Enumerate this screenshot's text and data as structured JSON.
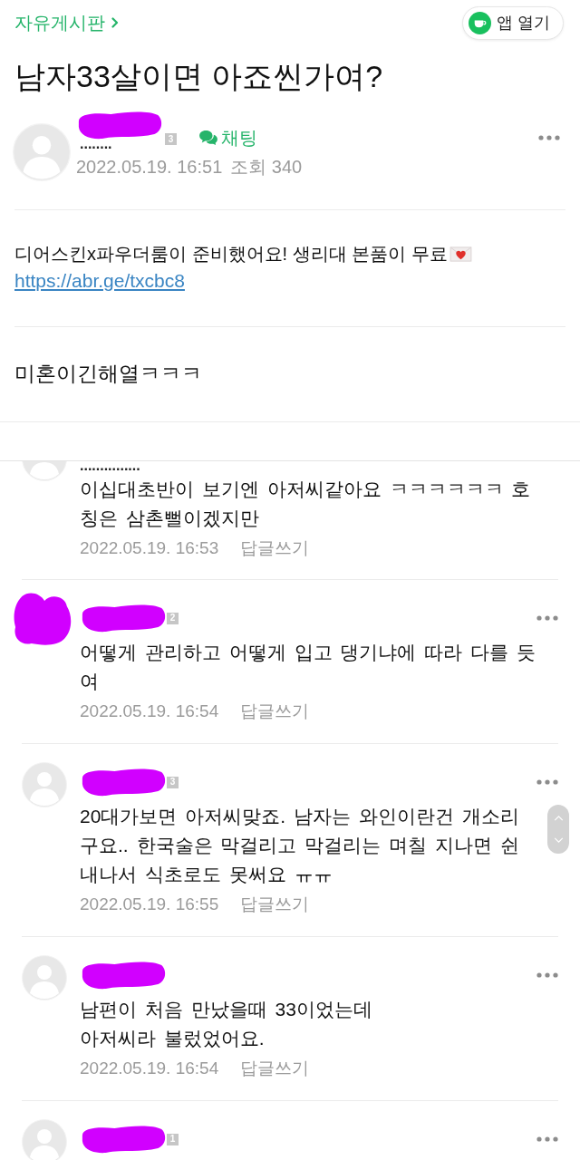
{
  "header": {
    "board_link": "자유게시판",
    "app_button": "앱 열기"
  },
  "post": {
    "title": "남자33살이면 아죠씬가여?",
    "author": {
      "name": "........",
      "redacted": true,
      "badge": "3",
      "chat_label": "채팅",
      "date": "2022.05.19. 16:51",
      "views": "조회 340",
      "more_menu": true
    },
    "ad": {
      "text": "디어스킨x파우더룸이 준비했어요! 생리대 본품이 무료",
      "link": "https://abr.ge/txcbc8"
    },
    "body": "미혼이긴해열ㅋㅋㅋ"
  },
  "comments": [
    {
      "cut_off_top": true,
      "avatar_redacted": false,
      "name": "...............",
      "redacted": false,
      "more_menu": false,
      "lines": [
        "이십대초반이 보기엔 아저씨같아요 ㅋㅋㅋㅋㅋㅋ 호",
        "칭은 삼촌뻘이겠지만"
      ],
      "date": "2022.05.19. 16:53",
      "reply_label": "답글쓰기"
    },
    {
      "cut_off_top": false,
      "avatar_redacted": true,
      "redacted": true,
      "badge": "2",
      "more_menu": true,
      "lines": [
        "어떻게 관리하고 어떻게 입고 댕기냐에 따라 다를 듯",
        "여"
      ],
      "date": "2022.05.19. 16:54",
      "reply_label": "답글쓰기"
    },
    {
      "cut_off_top": false,
      "avatar_redacted": false,
      "redacted": true,
      "badge": "3",
      "more_menu": true,
      "lines": [
        "20대가보면 아저씨맞죠. 남자는 와인이란건 개소리",
        "구요.. 한국술은 막걸리고 막걸리는 며칠 지나면 쉰",
        "내나서 식초로도 못써요 ㅠㅠ"
      ],
      "date": "2022.05.19. 16:55",
      "reply_label": "답글쓰기"
    },
    {
      "cut_off_top": false,
      "avatar_redacted": false,
      "redacted": true,
      "more_menu": true,
      "lines": [
        "남편이 처음 만났을때 33이었는데",
        "아저씨라 불렀었어요."
      ],
      "date": "2022.05.19. 16:54",
      "reply_label": "답글쓰기"
    },
    {
      "cut_off_top": false,
      "avatar_redacted": false,
      "redacted": true,
      "badge": "1",
      "more_menu": true
    }
  ]
}
